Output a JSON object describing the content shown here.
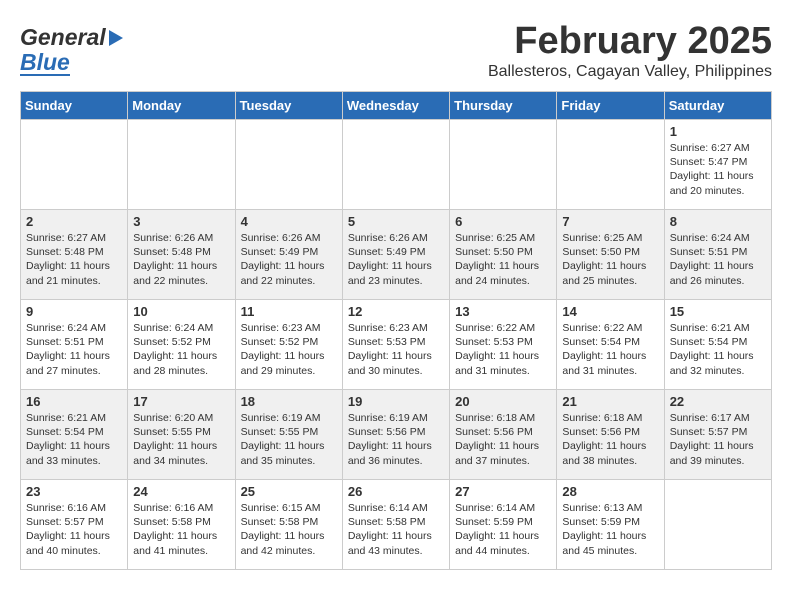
{
  "header": {
    "logo": {
      "general": "General",
      "blue": "Blue"
    },
    "title": "February 2025",
    "subtitle": "Ballesteros, Cagayan Valley, Philippines"
  },
  "calendar": {
    "days_of_week": [
      "Sunday",
      "Monday",
      "Tuesday",
      "Wednesday",
      "Thursday",
      "Friday",
      "Saturday"
    ],
    "weeks": [
      [
        {
          "day": "",
          "info": ""
        },
        {
          "day": "",
          "info": ""
        },
        {
          "day": "",
          "info": ""
        },
        {
          "day": "",
          "info": ""
        },
        {
          "day": "",
          "info": ""
        },
        {
          "day": "",
          "info": ""
        },
        {
          "day": "1",
          "info": "Sunrise: 6:27 AM\nSunset: 5:47 PM\nDaylight: 11 hours\nand 20 minutes."
        }
      ],
      [
        {
          "day": "2",
          "info": "Sunrise: 6:27 AM\nSunset: 5:48 PM\nDaylight: 11 hours\nand 21 minutes."
        },
        {
          "day": "3",
          "info": "Sunrise: 6:26 AM\nSunset: 5:48 PM\nDaylight: 11 hours\nand 22 minutes."
        },
        {
          "day": "4",
          "info": "Sunrise: 6:26 AM\nSunset: 5:49 PM\nDaylight: 11 hours\nand 22 minutes."
        },
        {
          "day": "5",
          "info": "Sunrise: 6:26 AM\nSunset: 5:49 PM\nDaylight: 11 hours\nand 23 minutes."
        },
        {
          "day": "6",
          "info": "Sunrise: 6:25 AM\nSunset: 5:50 PM\nDaylight: 11 hours\nand 24 minutes."
        },
        {
          "day": "7",
          "info": "Sunrise: 6:25 AM\nSunset: 5:50 PM\nDaylight: 11 hours\nand 25 minutes."
        },
        {
          "day": "8",
          "info": "Sunrise: 6:24 AM\nSunset: 5:51 PM\nDaylight: 11 hours\nand 26 minutes."
        }
      ],
      [
        {
          "day": "9",
          "info": "Sunrise: 6:24 AM\nSunset: 5:51 PM\nDaylight: 11 hours\nand 27 minutes."
        },
        {
          "day": "10",
          "info": "Sunrise: 6:24 AM\nSunset: 5:52 PM\nDaylight: 11 hours\nand 28 minutes."
        },
        {
          "day": "11",
          "info": "Sunrise: 6:23 AM\nSunset: 5:52 PM\nDaylight: 11 hours\nand 29 minutes."
        },
        {
          "day": "12",
          "info": "Sunrise: 6:23 AM\nSunset: 5:53 PM\nDaylight: 11 hours\nand 30 minutes."
        },
        {
          "day": "13",
          "info": "Sunrise: 6:22 AM\nSunset: 5:53 PM\nDaylight: 11 hours\nand 31 minutes."
        },
        {
          "day": "14",
          "info": "Sunrise: 6:22 AM\nSunset: 5:54 PM\nDaylight: 11 hours\nand 31 minutes."
        },
        {
          "day": "15",
          "info": "Sunrise: 6:21 AM\nSunset: 5:54 PM\nDaylight: 11 hours\nand 32 minutes."
        }
      ],
      [
        {
          "day": "16",
          "info": "Sunrise: 6:21 AM\nSunset: 5:54 PM\nDaylight: 11 hours\nand 33 minutes."
        },
        {
          "day": "17",
          "info": "Sunrise: 6:20 AM\nSunset: 5:55 PM\nDaylight: 11 hours\nand 34 minutes."
        },
        {
          "day": "18",
          "info": "Sunrise: 6:19 AM\nSunset: 5:55 PM\nDaylight: 11 hours\nand 35 minutes."
        },
        {
          "day": "19",
          "info": "Sunrise: 6:19 AM\nSunset: 5:56 PM\nDaylight: 11 hours\nand 36 minutes."
        },
        {
          "day": "20",
          "info": "Sunrise: 6:18 AM\nSunset: 5:56 PM\nDaylight: 11 hours\nand 37 minutes."
        },
        {
          "day": "21",
          "info": "Sunrise: 6:18 AM\nSunset: 5:56 PM\nDaylight: 11 hours\nand 38 minutes."
        },
        {
          "day": "22",
          "info": "Sunrise: 6:17 AM\nSunset: 5:57 PM\nDaylight: 11 hours\nand 39 minutes."
        }
      ],
      [
        {
          "day": "23",
          "info": "Sunrise: 6:16 AM\nSunset: 5:57 PM\nDaylight: 11 hours\nand 40 minutes."
        },
        {
          "day": "24",
          "info": "Sunrise: 6:16 AM\nSunset: 5:58 PM\nDaylight: 11 hours\nand 41 minutes."
        },
        {
          "day": "25",
          "info": "Sunrise: 6:15 AM\nSunset: 5:58 PM\nDaylight: 11 hours\nand 42 minutes."
        },
        {
          "day": "26",
          "info": "Sunrise: 6:14 AM\nSunset: 5:58 PM\nDaylight: 11 hours\nand 43 minutes."
        },
        {
          "day": "27",
          "info": "Sunrise: 6:14 AM\nSunset: 5:59 PM\nDaylight: 11 hours\nand 44 minutes."
        },
        {
          "day": "28",
          "info": "Sunrise: 6:13 AM\nSunset: 5:59 PM\nDaylight: 11 hours\nand 45 minutes."
        },
        {
          "day": "",
          "info": ""
        }
      ]
    ]
  }
}
